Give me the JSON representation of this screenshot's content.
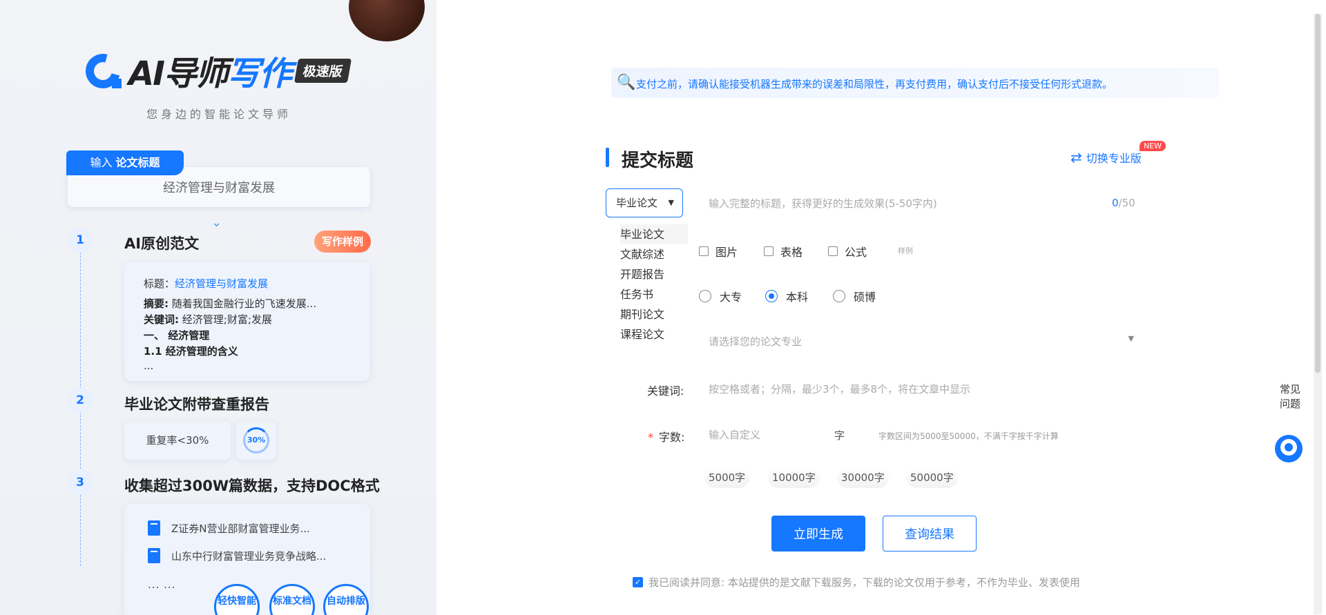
{
  "brand": {
    "logo_prefix": "AI导师",
    "logo_suffix": "写作",
    "badge": "极速版",
    "slogan": "您身边的智能论文导师"
  },
  "left": {
    "input_tab_prefix": "输入",
    "input_tab_bold": "论文标题",
    "input_value": "经济管理与财富发展",
    "chevron": "⌄",
    "steps": [
      {
        "num": "1",
        "title": "AI原创范文"
      },
      {
        "num": "2",
        "title": "毕业论文附带查重报告"
      },
      {
        "num": "3",
        "title": "收集超过300W篇数据，支持DOC格式"
      }
    ],
    "sample_button": "写作样例",
    "essay": {
      "title_label": "标题：",
      "title_value": "经济管理与财富发展",
      "abstract_label": "摘要:",
      "abstract_value": "随着我国金融行业的飞速发展...",
      "keywords_label": "关键词:",
      "keywords_value": "经济管理;财富;发展",
      "heading1": "一、 经济管理",
      "heading2": "1.1 经济管理的含义",
      "ellipsis": "..."
    },
    "rate_text": "重复率<30%",
    "rate_circle": "30%",
    "docs": [
      "Z证券N营业部财富管理业务...",
      "山东中行财富管理业务竞争战略..."
    ],
    "docs_more": "... ...",
    "features": [
      "轻快智能",
      "标准文档",
      "自动排版"
    ]
  },
  "notice": {
    "icon": "🔍",
    "text": "支付之前，请确认能接受机器生成带来的误差和局限性，再支付费用，确认支付后不接受任何形式退款。"
  },
  "form": {
    "section_title": "提交标题",
    "switch_label": "切换专业版",
    "new_badge": "NEW",
    "type_selected": "毕业论文",
    "type_options": [
      "毕业论文",
      "文献综述",
      "开题报告",
      "任务书",
      "期刊论文",
      "课程论文"
    ],
    "title_placeholder": "输入完整的标题，获得更好的生成效果(5-50字内)",
    "counter_current": "0",
    "counter_max": "/50",
    "checks": [
      "图片",
      "表格",
      "公式"
    ],
    "check_hint": "样例",
    "levels": [
      "大专",
      "本科",
      "硕博"
    ],
    "level_selected": "本科",
    "major_placeholder": "请选择您的论文专业",
    "keywords_label": "关键词:",
    "keywords_placeholder": "按空格或者；分隔，最少3个，最多8个，将在文章中显示",
    "wordcount_required": "*",
    "wordcount_label": "字数:",
    "wordcount_placeholder": "输入自定义",
    "wordcount_unit": "字",
    "wordcount_hint": "字数区间为5000至50000，不满千字按千字计算",
    "presets": [
      "5000字",
      "10000字",
      "30000字",
      "50000字"
    ],
    "generate_button": "立即生成",
    "query_button": "查询结果",
    "agree_text": "我已阅读并同意: 本站提供的是文献下载服务，下载的论文仅用于参考，不作为毕业、发表使用"
  },
  "sidebar": {
    "faq_line1": "常见",
    "faq_line2": "问题"
  },
  "colors": {
    "accent": "#1677ff",
    "sample_gradient_start": "#ffa37a",
    "sample_gradient_end": "#ff6b4a",
    "new_badge": "#ff4a4a"
  }
}
